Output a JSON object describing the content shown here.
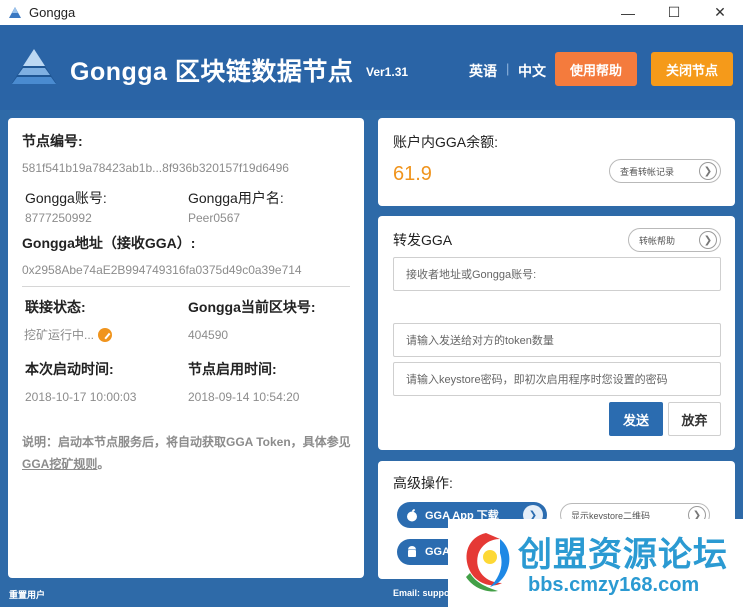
{
  "window": {
    "title": "Gongga"
  },
  "header": {
    "title": "Gongga 区块链数据节点",
    "version": "Ver1.31",
    "lang_en": "英语",
    "lang_separator": "|",
    "lang_zh": "中文",
    "help_label": "使用帮助",
    "close_node_label": "关闭节点"
  },
  "node": {
    "id_label": "节点编号:",
    "id_value": "581f541b19a78423ab1b...8f936b320157f19d6496",
    "account_label": "Gongga账号:",
    "account_value": "8777250992",
    "username_label": "Gongga用户名:",
    "username_value": "Peer0567",
    "address_label": "Gongga地址（接收GGA）:",
    "address_value": "0x2958Abe74aE2B994749316fa0375d49c0a39e714",
    "status_label": "联接状态:",
    "status_value": "挖矿运行中...",
    "block_label": "Gongga当前区块号:",
    "block_value": "404590",
    "start_label": "本次启动时间:",
    "start_value": "2018-10-17 10:00:03",
    "enable_label": "节点启用时间:",
    "enable_value": "2018-09-14 10:54:20",
    "note_text": "说明：启动本节点服务后，将自动获取GGA Token，具体参见",
    "note_link": "GGA挖矿规则",
    "note_end": "。"
  },
  "balance": {
    "label": "账户内GGA余额:",
    "value": "61.9",
    "history_label": "查看转帐记录"
  },
  "transfer": {
    "title": "转发GGA",
    "help_label": "转帐帮助",
    "recipient_placeholder": "接收者地址或Gongga账号:",
    "amount_placeholder": "请输入发送给对方的token数量",
    "password_placeholder": "请输入keystore密码，即初次启用程序时您设置的密码",
    "send_label": "发送",
    "cancel_label": "放弃"
  },
  "advanced": {
    "title": "高级操作:",
    "ios_download_label": "GGA App 下载",
    "android_label": "GGA",
    "keystore_qr_label": "显示keystore二维码"
  },
  "status": {
    "left": "重置用户",
    "right": "Email: suppo"
  },
  "watermark": {
    "text": "创盟资源论坛",
    "url": "bbs.cmzy168.com"
  },
  "colors": {
    "header_bg": "#2a64a6",
    "help_button": "#f47b3d",
    "close_button": "#f59a1a",
    "balance": "#f0941d",
    "primary": "#2b6cb0"
  }
}
